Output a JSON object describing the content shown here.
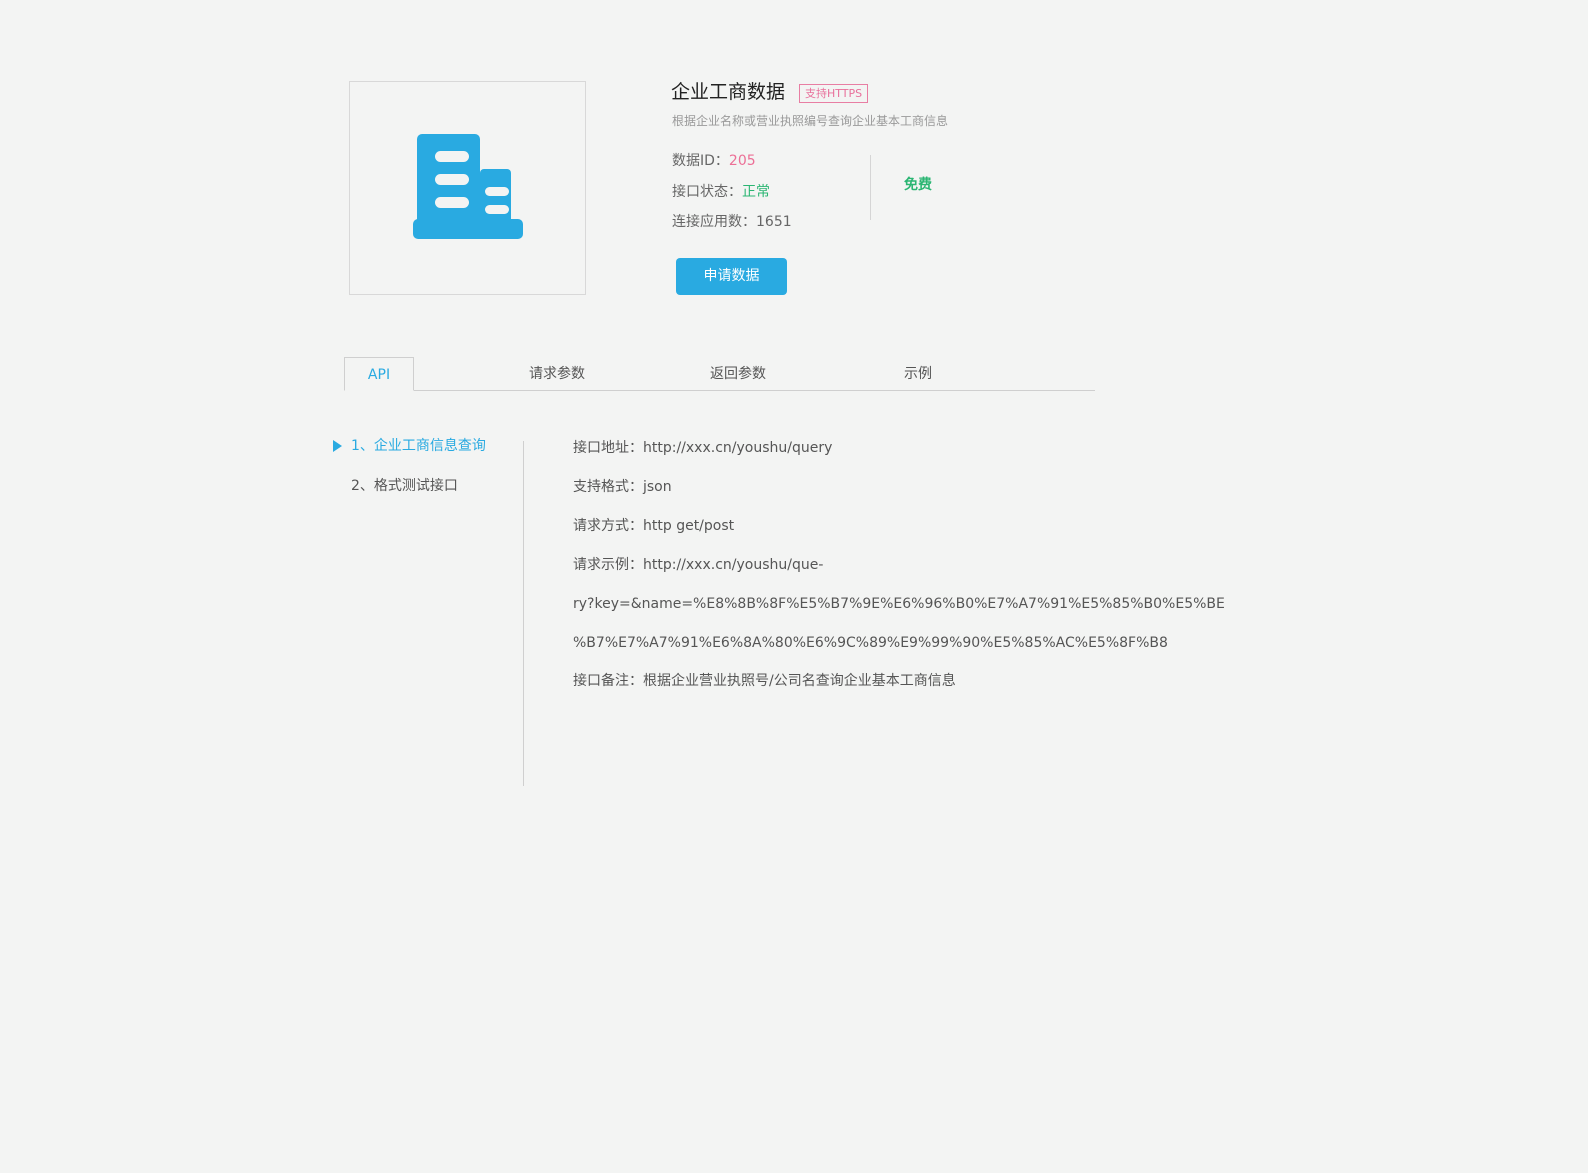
{
  "product": {
    "title": "企业工商数据",
    "badge": "支持HTTPS",
    "description": "根据企业名称或营业执照编号查询企业基本工商信息",
    "icon": "building-icon",
    "accent_color": "#29aae1",
    "id_label": "数据ID：",
    "id_value": "205",
    "status_label": "接口状态：",
    "status_value": "正常",
    "apps_label": "连接应用数：",
    "apps_value": "1651",
    "price": "免费",
    "apply_button": "申请数据"
  },
  "tabs": [
    {
      "label": "API",
      "active": true
    },
    {
      "label": "请求参数",
      "active": false
    },
    {
      "label": "返回参数",
      "active": false
    },
    {
      "label": "示例",
      "active": false
    }
  ],
  "sidebar": {
    "items": [
      {
        "label": "1、企业工商信息查询",
        "active": true
      },
      {
        "label": "2、格式测试接口",
        "active": false
      }
    ]
  },
  "detail": {
    "lines": [
      "接口地址：http://xxx.cn/youshu/query",
      "支持格式：json",
      "请求方式：http get/post",
      "请求示例：http://xxx.cn/youshu/que-",
      "ry?key=&name=%E8%8B%8F%E5%B7%9E%E6%96%B0%E7%A7%91%E5%85%B0%E5%BE",
      "%B7%E7%A7%91%E6%8A%80%E6%9C%89%E9%99%90%E5%85%AC%E5%8F%B8",
      "接口备注：根据企业营业执照号/公司名查询企业基本工商信息"
    ]
  },
  "colors": {
    "pink": "#ec6f96",
    "green": "#2bb673",
    "blue": "#29aae1"
  }
}
